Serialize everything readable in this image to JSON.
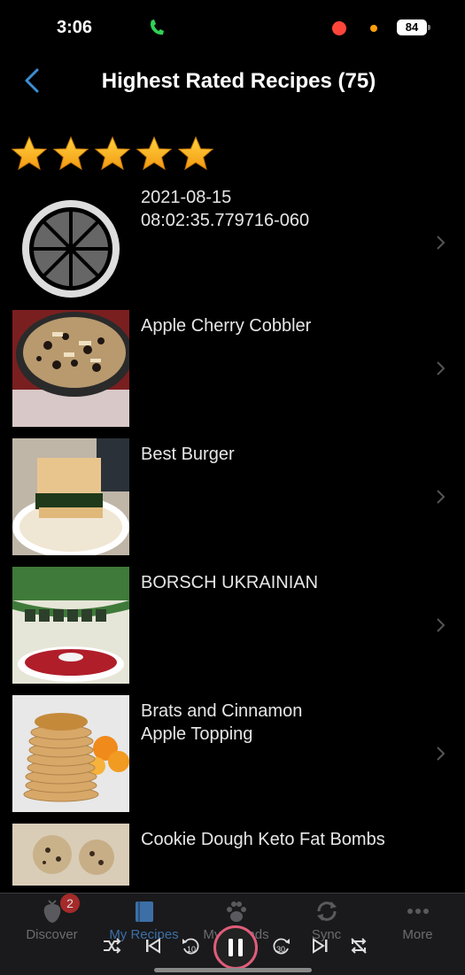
{
  "status": {
    "time": "3:06",
    "battery": "84",
    "call_icon": "phone-icon",
    "colors": {
      "call": "#30d158",
      "record": "#ff453a",
      "mic": "#ff9f0a"
    }
  },
  "nav": {
    "back_icon": "chevron-left-icon",
    "title": "Highest Rated Recipes (75)",
    "accent": "#3c8fd6"
  },
  "rating": {
    "stars": 5,
    "max": 5,
    "icon": "star-icon"
  },
  "recipes": [
    {
      "title": "2021-08-15\n08:02:35.779716-060",
      "image": "placeholder-logo"
    },
    {
      "title": "Apple Cherry Cobbler",
      "image": "cobbler-photo"
    },
    {
      "title": "Best Burger",
      "image": "burger-photo"
    },
    {
      "title": "BORSCH UKRAINIAN",
      "image": "borscht-package-photo"
    },
    {
      "title": "Brats and Cinnamon\nApple Topping",
      "image": "pancakes-photo"
    },
    {
      "title": "Cookie Dough Keto Fat Bombs",
      "image": "cookie-dough-photo"
    }
  ],
  "tabbar": {
    "tabs": [
      {
        "label": "Discover",
        "icon": "strawberry-icon",
        "badge": "2"
      },
      {
        "label": "My Recipes",
        "icon": "book-icon",
        "active": true
      },
      {
        "label": "My Friends",
        "icon": "paw-icon"
      },
      {
        "label": "Sync",
        "icon": "sync-icon"
      },
      {
        "label": "More",
        "icon": "more-icon"
      }
    ]
  },
  "media_controls": {
    "icons": [
      "shuffle-icon",
      "previous-icon",
      "rewind-10-icon",
      "pause-icon",
      "forward-30-icon",
      "next-icon",
      "repeat-off-icon"
    ],
    "skip_back": "10",
    "skip_forward": "30"
  }
}
